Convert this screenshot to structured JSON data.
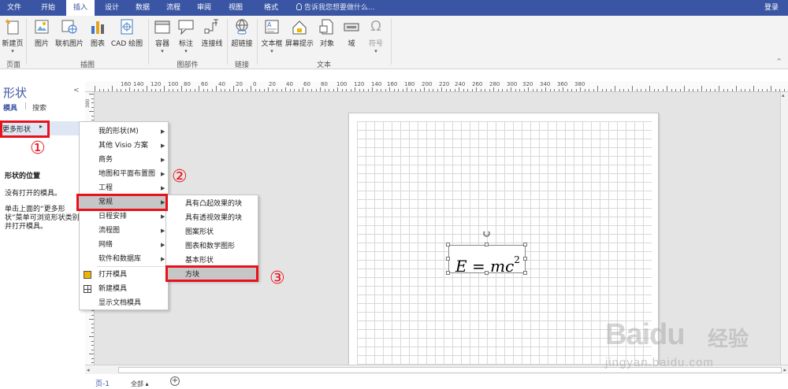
{
  "tabs": [
    "文件",
    "开始",
    "插入",
    "设计",
    "数据",
    "流程",
    "审阅",
    "视图",
    "格式"
  ],
  "active_tab": "插入",
  "tell_me": "告诉我您想要做什么...",
  "login": "登录",
  "ribbon": {
    "buttons": {
      "new_page": "新建页",
      "picture": "图片",
      "online_picture": "联机图片",
      "chart": "图表",
      "cad": "CAD 绘图",
      "container": "容器",
      "callout": "标注",
      "connector": "连接线",
      "hyperlink": "超链接",
      "textbox": "文本框",
      "screentip": "屏幕提示",
      "object": "对象",
      "field": "域",
      "symbol": "符号",
      "symbol_glyph": "Ω"
    },
    "groups": {
      "pages": "页面",
      "illustrations": "插图",
      "diagram_parts": "图部件",
      "links": "链接",
      "text": "文本"
    }
  },
  "shapes_pane": {
    "title": "形状",
    "tab_stencils": "模具",
    "tab_search": "搜索",
    "more_shapes": "更多形状",
    "location_title": "形状的位置",
    "no_stencils": "没有打开的模具。",
    "help_text": "单击上面的“更多形状”菜单可浏览形状类别并打开模具。"
  },
  "ruler_h": [
    "160",
    "140",
    "120",
    "100",
    "80",
    "60",
    "40",
    "20",
    "0",
    "20",
    "40",
    "60",
    "80",
    "100",
    "120",
    "140",
    "160",
    "180",
    "200",
    "220",
    "240",
    "260",
    "280",
    "300",
    "320",
    "340",
    "360",
    "380"
  ],
  "ruler_v": [
    "380",
    "200",
    "220",
    "240",
    "260",
    "280",
    "300",
    "320",
    "340",
    "360"
  ],
  "menu_main": [
    {
      "label": "我的形状(M)",
      "sub": true
    },
    {
      "label": "其他 Visio 方案",
      "sub": true
    },
    {
      "label": "商务",
      "sub": true
    },
    {
      "label": "地图和平面布置图",
      "sub": true
    },
    {
      "label": "工程",
      "sub": true
    },
    {
      "label": "常规",
      "sub": true
    },
    {
      "label": "日程安排",
      "sub": true
    },
    {
      "label": "流程图",
      "sub": true
    },
    {
      "label": "网络",
      "sub": true
    },
    {
      "label": "软件和数据库",
      "sub": true
    },
    {
      "label": "打开模具",
      "sub": false
    },
    {
      "label": "新建模具",
      "sub": false
    },
    {
      "label": "显示文档模具",
      "sub": false
    }
  ],
  "menu_sub": [
    {
      "label": "具有凸起效果的块"
    },
    {
      "label": "具有透视效果的块"
    },
    {
      "label": "图案形状"
    },
    {
      "label": "图表和数学图形"
    },
    {
      "label": "基本形状"
    },
    {
      "label": "方块"
    }
  ],
  "formula": {
    "main": "E = mc",
    "sup": "2"
  },
  "annotations": [
    "①",
    "②",
    "③"
  ],
  "status": {
    "page_tab": "页-1",
    "all_pages": "全部 ▴",
    "add_page": "+"
  },
  "watermark": {
    "brand": "Baidu",
    "cn": "经验",
    "url": "jingyan.baidu.com"
  },
  "colors": {
    "accent": "#3955a3",
    "highlight_box": "#e8121b",
    "selection": "#c6c6c6"
  }
}
